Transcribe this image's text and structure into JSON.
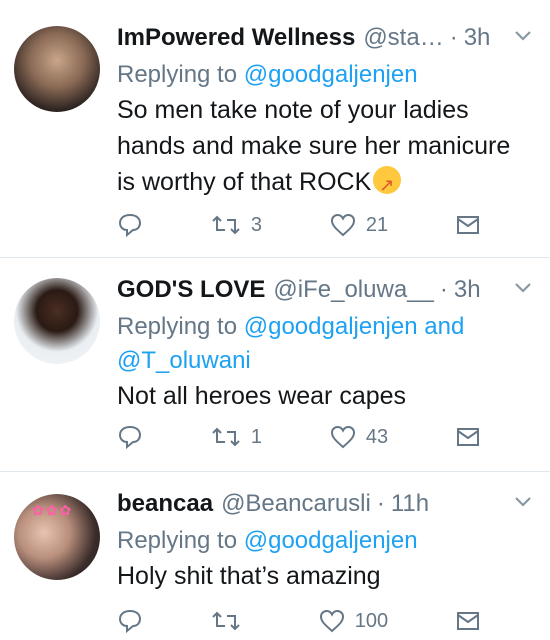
{
  "tweets": [
    {
      "name": "ImPowered Wellness",
      "handle": "@sta…",
      "time": "3h",
      "replying_prefix": "Replying to ",
      "replying_targets": "@goodgaljenjen",
      "text_lines": [
        "So men take note of your ladies",
        "hands and make sure her manicure",
        "is worthy of that ROCK"
      ],
      "emoji_icon": "rolling-laughing-emoji",
      "retweet_count": "3",
      "like_count": "21"
    },
    {
      "name": "GOD'S LOVE",
      "handle": "@iFe_oluwa__",
      "time": "3h",
      "replying_prefix": "Replying to ",
      "replying_targets_line1": "@goodgaljenjen and",
      "replying_targets_line2": "@T_oluwani",
      "text_lines": [
        "Not all heroes wear capes"
      ],
      "retweet_count": "1",
      "like_count": "43"
    },
    {
      "name": "beancaa",
      "handle": "@Beancarusli",
      "time": "11h",
      "replying_prefix": "Replying to ",
      "replying_targets": "@goodgaljenjen",
      "text_lines": [
        "Holy shit that’s amazing"
      ],
      "retweet_count": "",
      "like_count": "100"
    }
  ],
  "sep": "·",
  "chevron": "⌄",
  "colors": {
    "link": "#1da1f2",
    "muted": "#657786",
    "divider": "#e1e8ed"
  },
  "icons": [
    "reply-icon",
    "retweet-icon",
    "like-icon",
    "message-icon",
    "chevron-down-icon"
  ]
}
